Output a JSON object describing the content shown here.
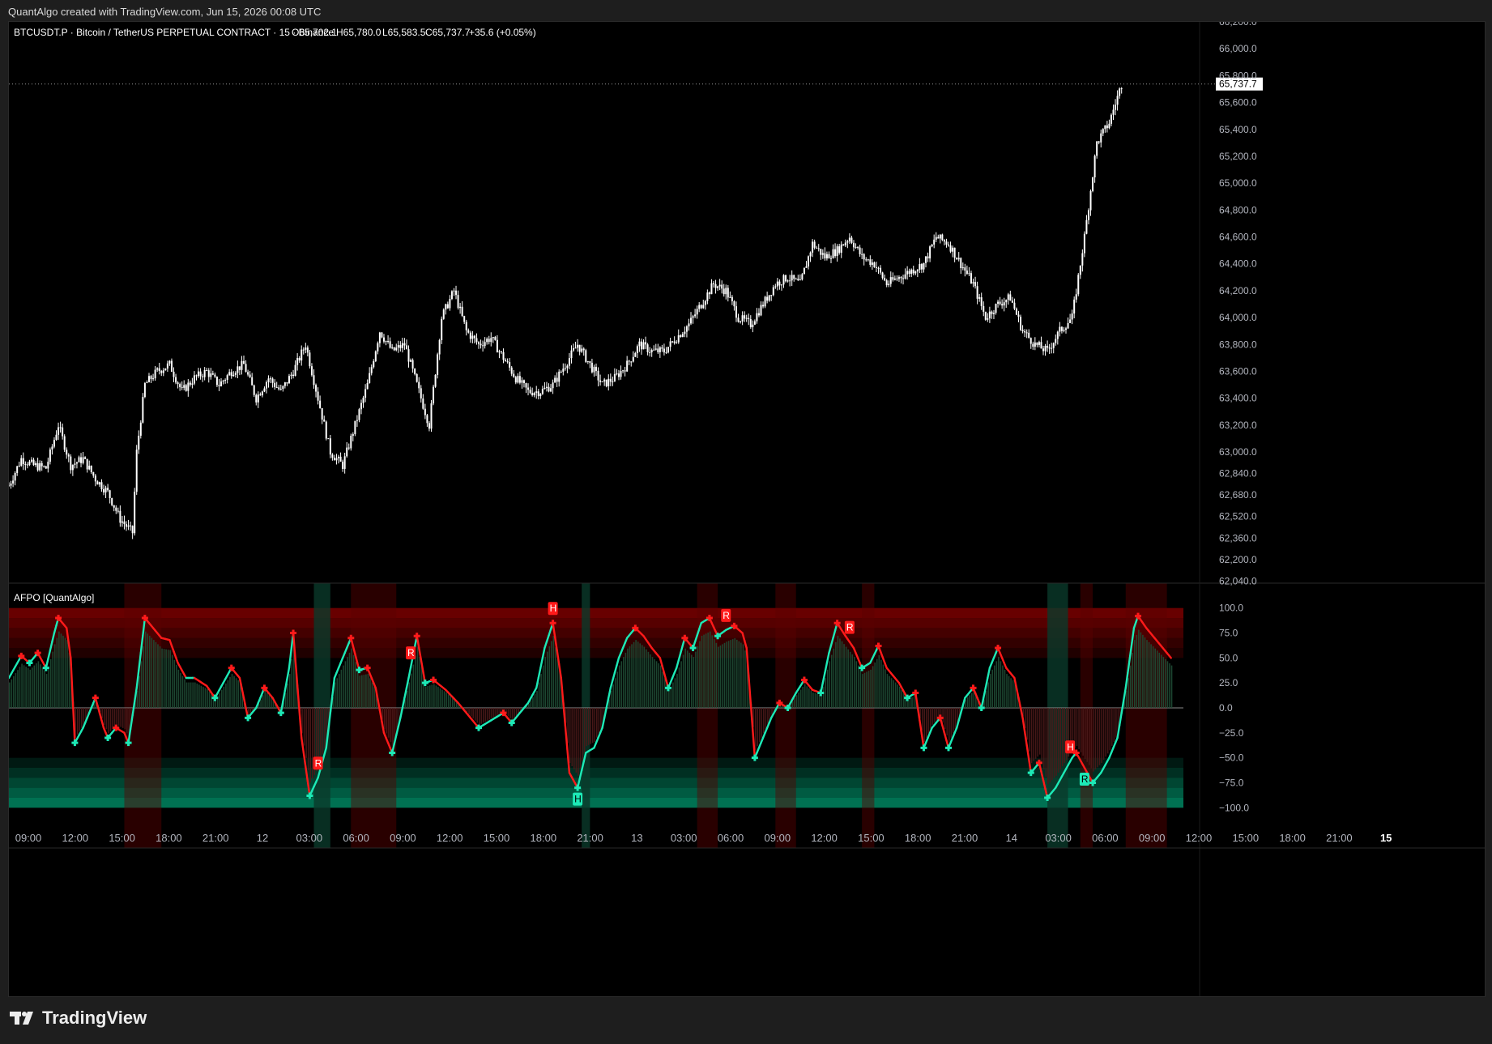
{
  "header": {
    "credit": "QuantAlgo created with TradingView.com, Jun 15, 2026 00:08 UTC"
  },
  "symbol_bar": {
    "symbol": "BTCUSDT.P · Bitcoin / TetherUS PERPETUAL CONTRACT · 15 · Binance",
    "open": "O65,702.1",
    "high": "H65,780.0",
    "low": "L65,583.5",
    "close": "C65,737.7",
    "change": "+35.6 (+0.05%)"
  },
  "indicator": {
    "name": "AFPO [QuantAlgo]"
  },
  "price_axis": {
    "labels": [
      "66,200.0",
      "66,000.0",
      "65,800.0",
      "65,600.0",
      "65,400.0",
      "65,200.0",
      "65,000.0",
      "64,800.0",
      "64,600.0",
      "64,400.0",
      "64,200.0",
      "64,000.0",
      "63,800.0",
      "63,600.0",
      "63,400.0",
      "63,200.0",
      "63,000.0",
      "62,840.0",
      "62,680.0",
      "62,520.0",
      "62,360.0",
      "62,200.0",
      "62,040.0"
    ],
    "last_price_label": "65,737.7"
  },
  "osc_axis": {
    "labels": [
      "100.0",
      "75.0",
      "50.0",
      "25.0",
      "0.0",
      "−25.0",
      "−50.0",
      "−75.0",
      "−100.0"
    ]
  },
  "time_axis": {
    "labels": [
      "09:00",
      "12:00",
      "15:00",
      "18:00",
      "21:00",
      "12",
      "03:00",
      "06:00",
      "09:00",
      "12:00",
      "15:00",
      "18:00",
      "21:00",
      "13",
      "03:00",
      "06:00",
      "09:00",
      "12:00",
      "15:00",
      "18:00",
      "21:00",
      "14",
      "03:00",
      "06:00",
      "09:00",
      "12:00",
      "15:00",
      "18:00",
      "21:00",
      "15"
    ]
  },
  "footer": {
    "brand": "TradingView"
  },
  "colors": {
    "background": "#000000",
    "candle": "#ffffff",
    "osc_up": "#1de9b6",
    "osc_down": "#ff1a1a",
    "ob_zone": "#8b0000",
    "os_zone": "#00a97a"
  },
  "chart_data": [
    {
      "type": "candlestick",
      "title": "BTCUSDT.P · Bitcoin / TetherUS PERPETUAL CONTRACT · 15 · Binance",
      "ylim": [
        62040,
        66200
      ],
      "last_price": 65737.7,
      "x_start": "Jun 12 ~08:00",
      "close_path": [
        [
          0,
          62750
        ],
        [
          6,
          62950
        ],
        [
          12,
          62900
        ],
        [
          18,
          62880
        ],
        [
          24,
          63200
        ],
        [
          30,
          62900
        ],
        [
          36,
          62950
        ],
        [
          42,
          62800
        ],
        [
          48,
          62700
        ],
        [
          54,
          62500
        ],
        [
          60,
          62400
        ],
        [
          62,
          63000
        ],
        [
          66,
          63500
        ],
        [
          72,
          63600
        ],
        [
          78,
          63650
        ],
        [
          84,
          63450
        ],
        [
          90,
          63550
        ],
        [
          96,
          63600
        ],
        [
          102,
          63500
        ],
        [
          108,
          63600
        ],
        [
          114,
          63650
        ],
        [
          120,
          63400
        ],
        [
          126,
          63550
        ],
        [
          132,
          63450
        ],
        [
          138,
          63600
        ],
        [
          144,
          63800
        ],
        [
          150,
          63400
        ],
        [
          156,
          63000
        ],
        [
          162,
          62900
        ],
        [
          168,
          63200
        ],
        [
          174,
          63500
        ],
        [
          180,
          63900
        ],
        [
          186,
          63750
        ],
        [
          192,
          63800
        ],
        [
          198,
          63500
        ],
        [
          204,
          63200
        ],
        [
          210,
          64000
        ],
        [
          216,
          64200
        ],
        [
          222,
          63900
        ],
        [
          228,
          63800
        ],
        [
          234,
          63850
        ],
        [
          240,
          63700
        ],
        [
          246,
          63550
        ],
        [
          252,
          63450
        ],
        [
          258,
          63450
        ],
        [
          264,
          63500
        ],
        [
          270,
          63650
        ],
        [
          276,
          63800
        ],
        [
          282,
          63650
        ],
        [
          288,
          63500
        ],
        [
          294,
          63550
        ],
        [
          300,
          63650
        ],
        [
          306,
          63800
        ],
        [
          312,
          63750
        ],
        [
          318,
          63750
        ],
        [
          324,
          63850
        ],
        [
          330,
          63950
        ],
        [
          336,
          64100
        ],
        [
          342,
          64250
        ],
        [
          348,
          64200
        ],
        [
          354,
          64000
        ],
        [
          360,
          63950
        ],
        [
          366,
          64100
        ],
        [
          372,
          64250
        ],
        [
          378,
          64300
        ],
        [
          384,
          64250
        ],
        [
          390,
          64550
        ],
        [
          396,
          64450
        ],
        [
          402,
          64500
        ],
        [
          408,
          64600
        ],
        [
          414,
          64450
        ],
        [
          420,
          64400
        ],
        [
          426,
          64250
        ],
        [
          432,
          64300
        ],
        [
          438,
          64350
        ],
        [
          444,
          64400
        ],
        [
          450,
          64600
        ],
        [
          456,
          64550
        ],
        [
          462,
          64400
        ],
        [
          468,
          64250
        ],
        [
          474,
          64000
        ],
        [
          480,
          64100
        ],
        [
          486,
          64150
        ],
        [
          492,
          63900
        ],
        [
          498,
          63800
        ],
        [
          504,
          63750
        ],
        [
          510,
          63900
        ],
        [
          516,
          64000
        ],
        [
          522,
          64600
        ],
        [
          528,
          65300
        ],
        [
          534,
          65450
        ],
        [
          540,
          65737.7
        ]
      ]
    },
    {
      "type": "area",
      "title": "AFPO [QuantAlgo]",
      "ylim": [
        -100,
        100
      ],
      "overbought_zone": [
        50,
        100
      ],
      "oversold_zone": [
        -100,
        -50
      ],
      "series_points": [
        [
          0,
          30
        ],
        [
          6,
          52
        ],
        [
          10,
          45
        ],
        [
          14,
          55
        ],
        [
          18,
          40
        ],
        [
          22,
          75
        ],
        [
          24,
          90
        ],
        [
          28,
          80
        ],
        [
          30,
          50
        ],
        [
          32,
          -35
        ],
        [
          36,
          -20
        ],
        [
          38,
          -10
        ],
        [
          42,
          10
        ],
        [
          46,
          -20
        ],
        [
          48,
          -30
        ],
        [
          52,
          -20
        ],
        [
          56,
          -25
        ],
        [
          58,
          -35
        ],
        [
          62,
          20
        ],
        [
          66,
          90
        ],
        [
          70,
          80
        ],
        [
          74,
          70
        ],
        [
          78,
          68
        ],
        [
          82,
          45
        ],
        [
          86,
          30
        ],
        [
          90,
          30
        ],
        [
          96,
          22
        ],
        [
          100,
          10
        ],
        [
          104,
          25
        ],
        [
          108,
          40
        ],
        [
          112,
          30
        ],
        [
          116,
          -10
        ],
        [
          120,
          0
        ],
        [
          124,
          20
        ],
        [
          128,
          10
        ],
        [
          132,
          -5
        ],
        [
          136,
          40
        ],
        [
          138,
          75
        ],
        [
          142,
          -30
        ],
        [
          146,
          -88
        ],
        [
          150,
          -70
        ],
        [
          154,
          -40
        ],
        [
          158,
          30
        ],
        [
          162,
          50
        ],
        [
          166,
          70
        ],
        [
          170,
          38
        ],
        [
          174,
          40
        ],
        [
          178,
          20
        ],
        [
          182,
          -25
        ],
        [
          186,
          -45
        ],
        [
          190,
          -10
        ],
        [
          194,
          30
        ],
        [
          198,
          72
        ],
        [
          202,
          25
        ],
        [
          206,
          28
        ],
        [
          212,
          18
        ],
        [
          218,
          5
        ],
        [
          224,
          -10
        ],
        [
          228,
          -20
        ],
        [
          232,
          -15
        ],
        [
          236,
          -10
        ],
        [
          240,
          -5
        ],
        [
          244,
          -15
        ],
        [
          248,
          -5
        ],
        [
          252,
          5
        ],
        [
          256,
          20
        ],
        [
          260,
          60
        ],
        [
          264,
          85
        ],
        [
          268,
          30
        ],
        [
          272,
          -65
        ],
        [
          276,
          -80
        ],
        [
          280,
          -45
        ],
        [
          284,
          -40
        ],
        [
          288,
          -20
        ],
        [
          292,
          20
        ],
        [
          296,
          50
        ],
        [
          300,
          70
        ],
        [
          304,
          80
        ],
        [
          308,
          72
        ],
        [
          312,
          60
        ],
        [
          316,
          50
        ],
        [
          320,
          20
        ],
        [
          324,
          40
        ],
        [
          328,
          70
        ],
        [
          332,
          60
        ],
        [
          336,
          85
        ],
        [
          340,
          90
        ],
        [
          344,
          72
        ],
        [
          348,
          78
        ],
        [
          352,
          82
        ],
        [
          356,
          75
        ],
        [
          358,
          60
        ],
        [
          362,
          -50
        ],
        [
          366,
          -30
        ],
        [
          370,
          -10
        ],
        [
          374,
          5
        ],
        [
          378,
          0
        ],
        [
          382,
          15
        ],
        [
          386,
          28
        ],
        [
          390,
          18
        ],
        [
          394,
          15
        ],
        [
          398,
          55
        ],
        [
          402,
          85
        ],
        [
          406,
          72
        ],
        [
          410,
          60
        ],
        [
          414,
          40
        ],
        [
          418,
          45
        ],
        [
          422,
          62
        ],
        [
          426,
          40
        ],
        [
          432,
          25
        ],
        [
          436,
          10
        ],
        [
          440,
          15
        ],
        [
          444,
          -40
        ],
        [
          448,
          -20
        ],
        [
          452,
          -10
        ],
        [
          456,
          -40
        ],
        [
          460,
          -20
        ],
        [
          464,
          10
        ],
        [
          468,
          20
        ],
        [
          472,
          0
        ],
        [
          476,
          40
        ],
        [
          480,
          60
        ],
        [
          484,
          40
        ],
        [
          488,
          30
        ],
        [
          492,
          -10
        ],
        [
          496,
          -65
        ],
        [
          500,
          -55
        ],
        [
          504,
          -90
        ],
        [
          508,
          -80
        ],
        [
          512,
          -65
        ],
        [
          516,
          -50
        ],
        [
          518,
          -45
        ],
        [
          522,
          -60
        ],
        [
          526,
          -75
        ],
        [
          530,
          -65
        ],
        [
          534,
          -50
        ],
        [
          538,
          -30
        ],
        [
          542,
          20
        ],
        [
          546,
          80
        ],
        [
          548,
          92
        ],
        [
          552,
          80
        ],
        [
          556,
          70
        ],
        [
          560,
          60
        ],
        [
          564,
          50
        ]
      ],
      "markers": [
        {
          "label": "R",
          "tone": "down",
          "x": 150
        },
        {
          "label": "R",
          "tone": "down",
          "x": 195
        },
        {
          "label": "H",
          "tone": "down",
          "x": 264
        },
        {
          "label": "H",
          "tone": "up",
          "x": 276
        },
        {
          "label": "R",
          "tone": "down",
          "x": 348
        },
        {
          "label": "R",
          "tone": "down",
          "x": 408
        },
        {
          "label": "H",
          "tone": "down",
          "x": 515
        },
        {
          "label": "R",
          "tone": "up",
          "x": 522
        }
      ]
    }
  ]
}
